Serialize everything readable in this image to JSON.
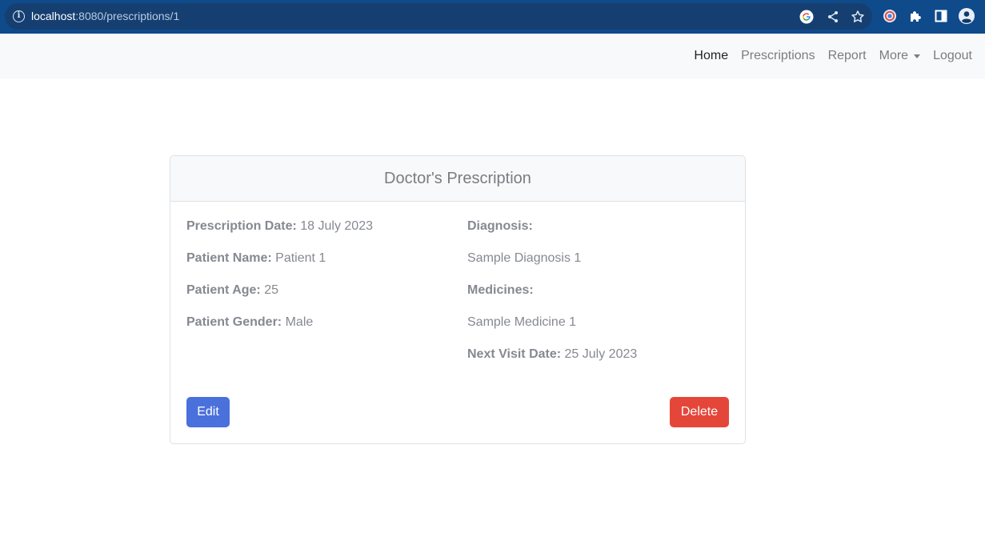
{
  "browser": {
    "url_host": "localhost",
    "url_rest": ":8080/prescriptions/1",
    "icons": [
      "info-icon",
      "google-icon",
      "share-icon",
      "bookmark-star-icon",
      "extension-color-icon",
      "puzzle-icon",
      "side-panel-icon",
      "profile-icon"
    ]
  },
  "navbar": {
    "items": [
      {
        "label": "Home",
        "active": true
      },
      {
        "label": "Prescriptions",
        "active": false
      },
      {
        "label": "Report",
        "active": false
      },
      {
        "label": "More",
        "active": false,
        "dropdown": true
      },
      {
        "label": "Logout",
        "active": false
      }
    ]
  },
  "card": {
    "title": "Doctor's Prescription",
    "left": {
      "prescription_date_label": "Prescription Date:",
      "prescription_date_value": "18 July 2023",
      "patient_name_label": "Patient Name:",
      "patient_name_value": "Patient 1",
      "patient_age_label": "Patient Age:",
      "patient_age_value": "25",
      "patient_gender_label": "Patient Gender:",
      "patient_gender_value": "Male"
    },
    "right": {
      "diagnosis_label": "Diagnosis:",
      "diagnosis_value": "Sample Diagnosis 1",
      "medicines_label": "Medicines:",
      "medicines_value": "Sample Medicine 1",
      "next_visit_label": "Next Visit Date:",
      "next_visit_value": "25 July 2023"
    },
    "edit_label": "Edit",
    "delete_label": "Delete"
  },
  "colors": {
    "browser_bar": "#0f4a8a",
    "edit_button": "#4a70db",
    "delete_button": "#e4473a"
  }
}
